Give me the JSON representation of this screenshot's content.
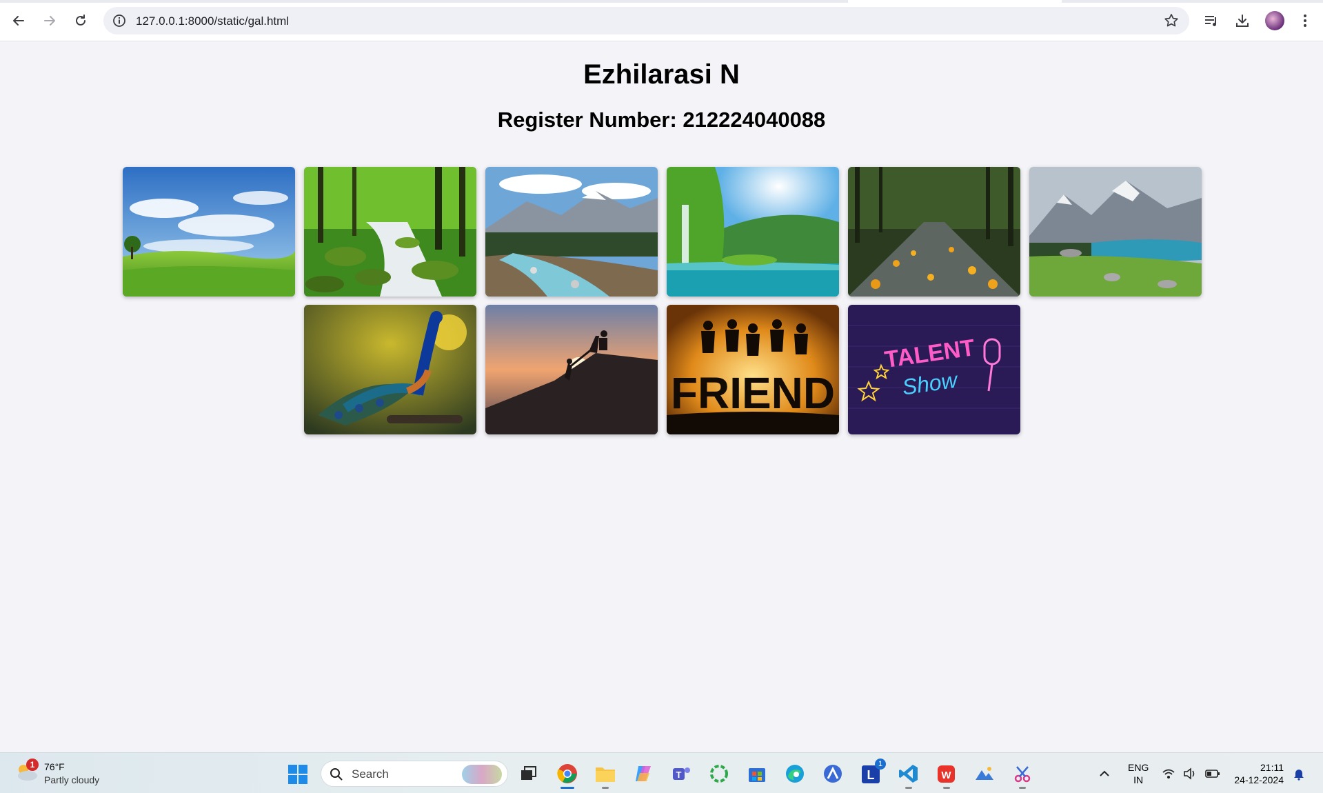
{
  "browser": {
    "url": "127.0.0.1:8000/static/gal.html"
  },
  "page": {
    "title": "Ezhilarasi N",
    "subtitle": "Register Number: 212224040088"
  },
  "gallery": {
    "images": [
      {
        "name": "meadow-sky-image"
      },
      {
        "name": "forest-stream-image"
      },
      {
        "name": "mountain-river-image"
      },
      {
        "name": "waterfall-lake-image"
      },
      {
        "name": "rainy-forest-road-image"
      },
      {
        "name": "alpine-lake-image"
      },
      {
        "name": "peacock-image"
      },
      {
        "name": "hikers-sunset-image"
      },
      {
        "name": "friend-silhouette-image",
        "text": "FRIEND"
      },
      {
        "name": "talent-show-neon-image",
        "text_line1": "TALENT",
        "text_line2": "Show"
      }
    ]
  },
  "taskbar": {
    "weather_temp": "76°F",
    "weather_condition": "Partly cloudy",
    "weather_badge": "1",
    "search_label": "Search",
    "lang_line1": "ENG",
    "lang_line2": "IN",
    "time": "21:11",
    "date": "24-12-2024",
    "l_app_badge": "1"
  }
}
